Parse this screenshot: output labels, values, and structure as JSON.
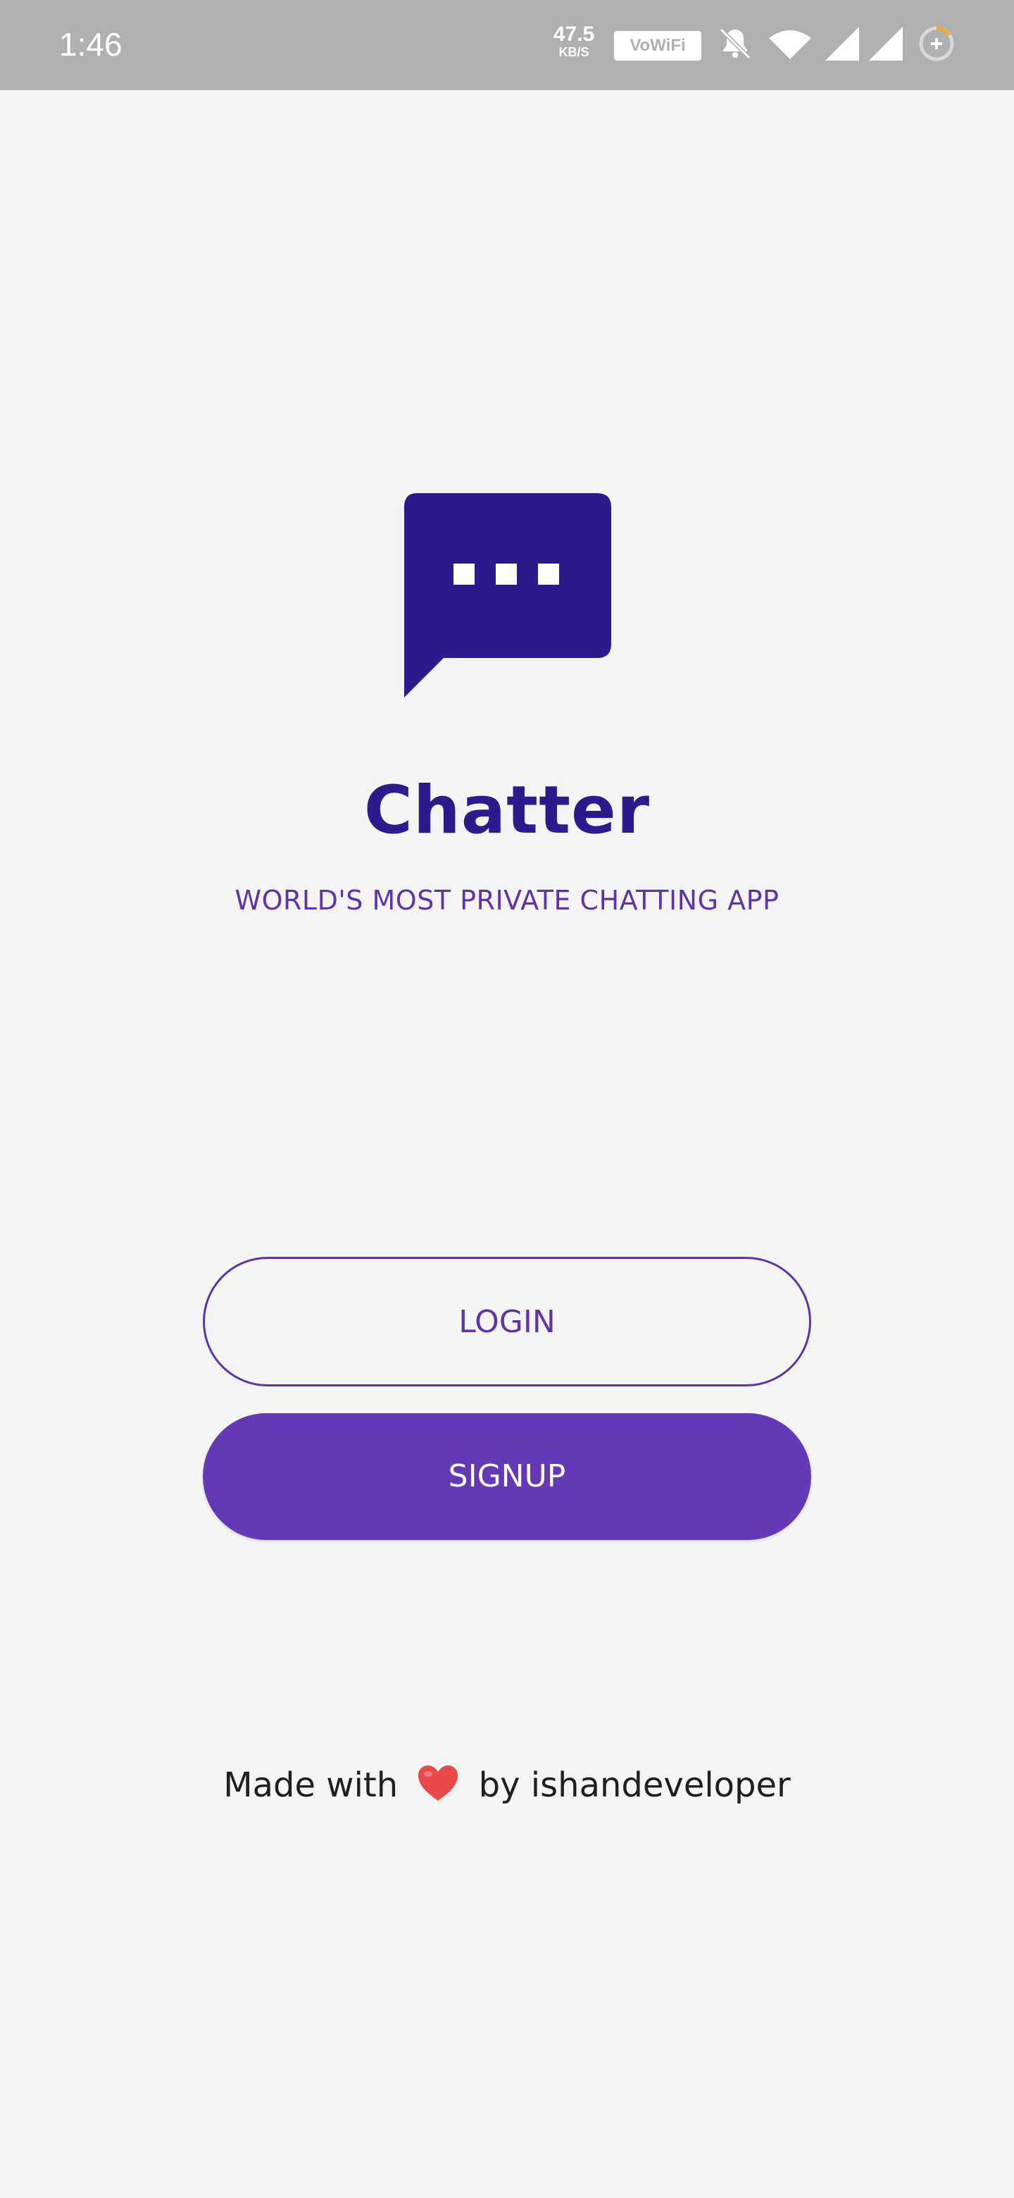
{
  "status_bar": {
    "time": "1:46",
    "net_speed": "47.5",
    "net_speed_unit": "KB/S",
    "vowifi_label": "VoWiFi"
  },
  "app": {
    "name": "Chatter",
    "tagline": "WORLD'S MOST PRIVATE CHATTING APP",
    "logo_icon": "chat-bubble-icon"
  },
  "buttons": {
    "login_label": "LOGIN",
    "signup_label": "SIGNUP"
  },
  "footer": {
    "prefix": "Made with",
    "heart_icon": "heart-icon",
    "suffix": "by ishandeveloper"
  },
  "colors": {
    "primary_dark": "#2d1b8e",
    "primary": "#6439b6",
    "accent_text": "#5e34a8",
    "background": "#f4f4f5",
    "status_bar": "#b0b0b0",
    "heart": "#e84a4a"
  }
}
